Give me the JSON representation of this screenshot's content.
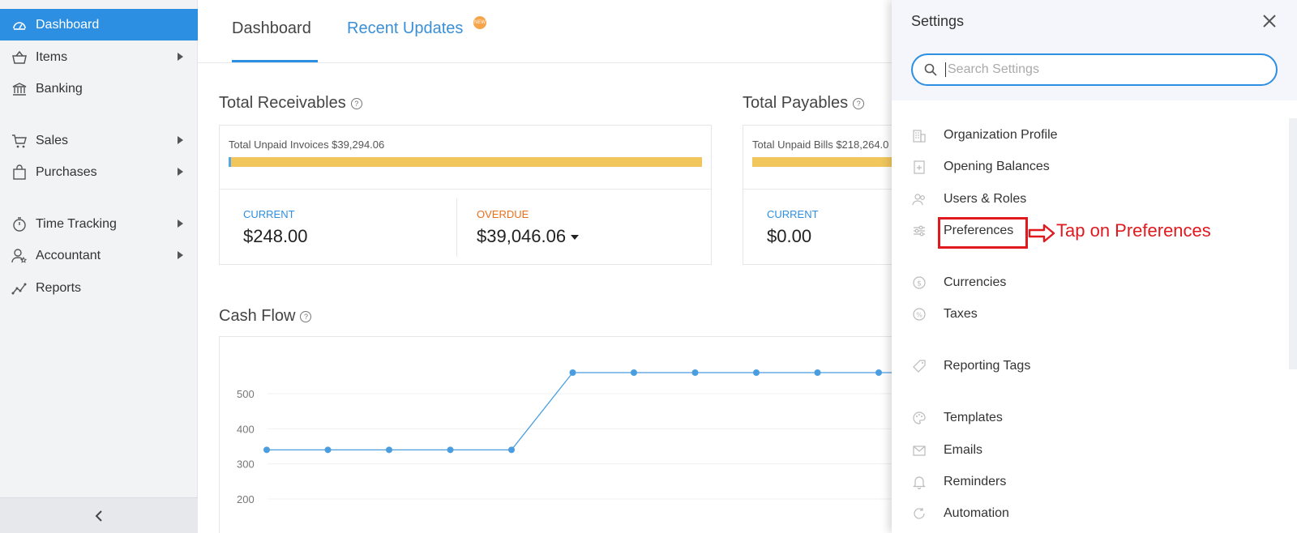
{
  "sidebar": {
    "items": [
      {
        "label": "Dashboard",
        "icon": "dashboard-icon",
        "active": true,
        "arrow": false
      },
      {
        "label": "Items",
        "icon": "basket-icon",
        "arrow": true
      },
      {
        "label": "Banking",
        "icon": "bank-icon",
        "arrow": false
      },
      {
        "label": "Sales",
        "icon": "cart-icon",
        "arrow": true
      },
      {
        "label": "Purchases",
        "icon": "bag-icon",
        "arrow": true
      },
      {
        "label": "Time Tracking",
        "icon": "stopwatch-icon",
        "arrow": true
      },
      {
        "label": "Accountant",
        "icon": "accountant-icon",
        "arrow": true
      },
      {
        "label": "Reports",
        "icon": "reports-icon",
        "arrow": false
      }
    ]
  },
  "tabs": {
    "dashboard": "Dashboard",
    "recent_updates": "Recent Updates",
    "badge": "NEW"
  },
  "receivables": {
    "title": "Total Receivables",
    "unpaid": "Total Unpaid Invoices $39,294.06",
    "current_label": "CURRENT",
    "current_value": "$248.00",
    "overdue_label": "OVERDUE",
    "overdue_value": "$39,046.06"
  },
  "payables": {
    "title": "Total Payables",
    "unpaid": "Total Unpaid Bills $218,264.0",
    "current_label": "CURRENT",
    "current_value": "$0.00"
  },
  "cashflow": {
    "title": "Cash Flow"
  },
  "chart_data": {
    "type": "line",
    "title": "Cash Flow",
    "yticks": [
      200,
      300,
      400,
      500
    ],
    "ylim": [
      150,
      600
    ],
    "series": [
      {
        "values": [
          340,
          340,
          340,
          340,
          340,
          560,
          560,
          560,
          560,
          560,
          560,
          560
        ]
      }
    ],
    "color": "#4a9ee0",
    "grid": true
  },
  "settings": {
    "title": "Settings",
    "search_placeholder": "Search Settings",
    "items": [
      {
        "label": "Organization Profile",
        "icon": "building-icon"
      },
      {
        "label": "Opening Balances",
        "icon": "ledger-icon"
      },
      {
        "label": "Users & Roles",
        "icon": "users-icon"
      },
      {
        "label": "Preferences",
        "icon": "sliders-icon"
      },
      {
        "label": "Currencies",
        "icon": "currency-icon"
      },
      {
        "label": "Taxes",
        "icon": "percent-icon"
      },
      {
        "label": "Reporting Tags",
        "icon": "tag-icon"
      },
      {
        "label": "Templates",
        "icon": "palette-icon"
      },
      {
        "label": "Emails",
        "icon": "envelope-icon"
      },
      {
        "label": "Reminders",
        "icon": "bell-icon"
      },
      {
        "label": "Automation",
        "icon": "refresh-icon"
      }
    ]
  },
  "annotation": {
    "text": "Tap on Preferences"
  }
}
